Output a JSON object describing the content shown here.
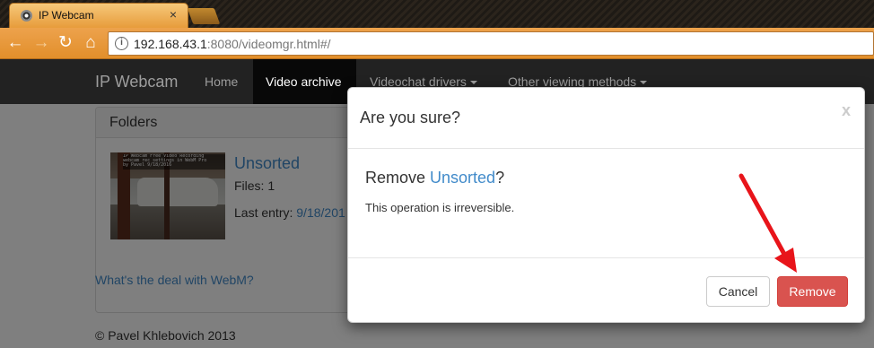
{
  "browser": {
    "tab_title": "IP Webcam",
    "tab_close": "×",
    "url_host": "192.168.43.1",
    "url_rest": ":8080/videomgr.html#/",
    "info_icon": "i"
  },
  "navbar": {
    "brand": "IP Webcam",
    "items": [
      {
        "label": "Home"
      },
      {
        "label": "Video archive"
      },
      {
        "label": "Videochat drivers"
      },
      {
        "label": "Other viewing methods"
      }
    ]
  },
  "folders_panel": {
    "heading": "Folders",
    "folder": {
      "name": "Unsorted",
      "files": "Files: 1",
      "last_entry_label": "Last entry: ",
      "last_entry_value": "9/18/201"
    },
    "thumbnail_overlay": "IP Webcam Free Video Recording\nwebcam rec settings in WebM Pro\nby Pavel 9/18/2016"
  },
  "webm_link": "What's the deal with WebM?",
  "footer": "© Pavel Khlebovich 2013",
  "modal": {
    "title": "Are you sure?",
    "close": "x",
    "remove_prefix": "Remove ",
    "folder_ref": "Unsorted",
    "remove_suffix": "?",
    "message": "This operation is irreversible.",
    "cancel_label": "Cancel",
    "remove_label": "Remove"
  },
  "colors": {
    "danger": "#d9534f",
    "link": "#428bca",
    "annotation_arrow": "#e8141a"
  }
}
